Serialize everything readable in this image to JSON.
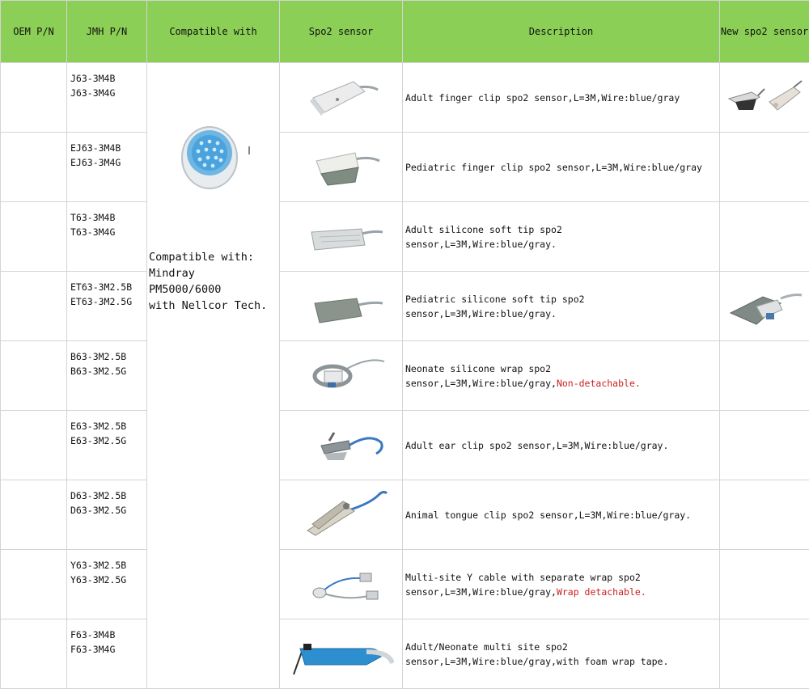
{
  "header": {
    "oem_pn": "OEM P/N",
    "jmh_pn": "JMH P/N",
    "compatible_with": "Compatible with",
    "spo2_sensor": "Spo2 sensor",
    "description": "Description",
    "new_spo2_sensor": "New spo2 sensor"
  },
  "compatible": {
    "text": "Compatible with:\nMindray\nPM5000/6000\nwith Nellcor Tech.",
    "connector_icon": "round-connector-icon"
  },
  "rows": [
    {
      "pn1": "J63-3M4B",
      "pn2": "J63-3M4G",
      "desc": "Adult finger clip spo2 sensor,L=3M,Wire:blue/gray",
      "desc_red": "",
      "sensor_icon": "adult-finger-clip-icon"
    },
    {
      "pn1": "EJ63-3M4B",
      "pn2": "EJ63-3M4G",
      "desc": "Pediatric finger clip spo2 sensor,L=3M,Wire:blue/gray",
      "desc_red": "",
      "sensor_icon": "pediatric-finger-clip-icon"
    },
    {
      "pn1": "T63-3M4B",
      "pn2": "T63-3M4G",
      "desc": "Adult silicone soft tip spo2\nsensor,L=3M,Wire:blue/gray.",
      "desc_red": "",
      "sensor_icon": "adult-soft-tip-icon"
    },
    {
      "pn1": "ET63-3M2.5B",
      "pn2": "ET63-3M2.5G",
      "desc": "Pediatric silicone soft tip spo2\nsensor,L=3M,Wire:blue/gray.",
      "desc_red": "",
      "sensor_icon": "pediatric-soft-tip-icon"
    },
    {
      "pn1": "B63-3M2.5B",
      "pn2": "B63-3M2.5G",
      "desc": "Neonate silicone wrap spo2\nsensor,L=3M,Wire:blue/gray,",
      "desc_red": "Non-detachable.",
      "sensor_icon": "neonate-wrap-icon"
    },
    {
      "pn1": "E63-3M2.5B",
      "pn2": "E63-3M2.5G",
      "desc": "Adult ear clip spo2 sensor,L=3M,Wire:blue/gray.",
      "desc_red": "",
      "sensor_icon": "ear-clip-icon"
    },
    {
      "pn1": "D63-3M2.5B",
      "pn2": "D63-3M2.5G",
      "desc": "Animal tongue clip spo2 sensor,L=3M,Wire:blue/gray.",
      "desc_red": "",
      "sensor_icon": "tongue-clip-icon"
    },
    {
      "pn1": "Y63-3M2.5B",
      "pn2": "Y63-3M2.5G",
      "desc": "Multi-site Y cable with separate wrap spo2\nsensor,L=3M,Wire:blue/gray,",
      "desc_red": "Wrap detachable.",
      "sensor_icon": "y-cable-icon"
    },
    {
      "pn1": "F63-3M4B",
      "pn2": "F63-3M4G",
      "desc": "Adult/Neonate multi site spo2\nsensor,L=3M,Wire:blue/gray,with foam wrap tape.",
      "desc_red": "",
      "sensor_icon": "foam-wrap-icon"
    }
  ],
  "new_sensor_icons": [
    "new-finger-clip-pair-icon",
    "new-soft-tip-icon"
  ],
  "colors": {
    "header_bg": "#8ccf56",
    "warning_text": "#cc1f1f",
    "grid": "#d4d4d4"
  }
}
